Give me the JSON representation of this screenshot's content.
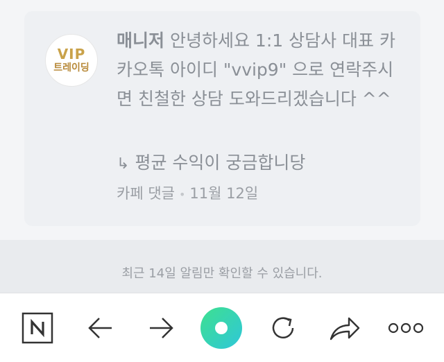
{
  "notification": {
    "avatar": {
      "line1": "VIP",
      "line2": "트레이딩"
    },
    "sender": "매니저",
    "message": " 안녕하세요 1:1 상담사 대표 카카오톡 아이디 \"vvip9\" 으로 연락주시면 친철한 상담 도와드리겠습니다 ^^",
    "reply": "평균 수익이 궁금합니당",
    "source": "카페 댓글",
    "date": "11월 12일"
  },
  "notice": "최근 14일 알림만 확인할 수 있습니다.",
  "toolbar": {
    "icons": [
      "naver-logo-icon",
      "back-arrow-icon",
      "forward-arrow-icon",
      "green-dot-icon",
      "refresh-icon",
      "share-icon",
      "more-icon"
    ]
  },
  "colors": {
    "accent_green_start": "#3ee08f",
    "accent_green_end": "#2fc7d9",
    "card_bg": "#eef0f3",
    "text": "#8a8f96"
  }
}
